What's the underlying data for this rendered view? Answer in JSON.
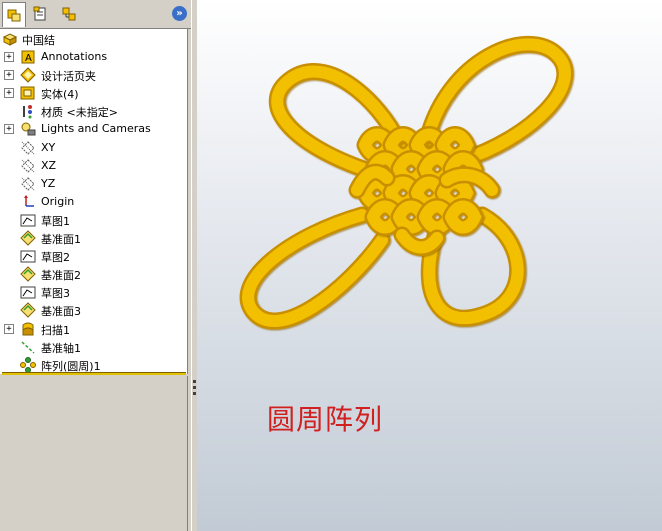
{
  "tabs": [
    {
      "name": "feature-manager",
      "icon": "feature-tree-icon"
    },
    {
      "name": "property-manager",
      "icon": "property-icon"
    },
    {
      "name": "configuration-manager",
      "icon": "configuration-icon"
    }
  ],
  "expand_glyph": "»",
  "tree": {
    "root": {
      "label": "中国结",
      "icon": "part-icon"
    },
    "items": [
      {
        "label": "Annotations",
        "icon": "annotations-icon",
        "expandable": true
      },
      {
        "label": "设计活页夹",
        "icon": "design-binder-icon",
        "expandable": true
      },
      {
        "label": "实体(4)",
        "icon": "solid-bodies-icon",
        "expandable": true
      },
      {
        "label": "材质 <未指定>",
        "icon": "material-icon",
        "expandable": false
      },
      {
        "label": "Lights and Cameras",
        "icon": "lights-cameras-icon",
        "expandable": true
      },
      {
        "label": "XY",
        "icon": "plane-icon",
        "expandable": false
      },
      {
        "label": "XZ",
        "icon": "plane-icon",
        "expandable": false
      },
      {
        "label": "YZ",
        "icon": "plane-icon",
        "expandable": false
      },
      {
        "label": "Origin",
        "icon": "origin-icon",
        "expandable": false
      },
      {
        "label": "草图1",
        "icon": "sketch-icon",
        "expandable": false
      },
      {
        "label": "基准面1",
        "icon": "reference-plane-icon",
        "expandable": false
      },
      {
        "label": "草图2",
        "icon": "sketch-icon",
        "expandable": false
      },
      {
        "label": "基准面2",
        "icon": "reference-plane-icon",
        "expandable": false
      },
      {
        "label": "草图3",
        "icon": "sketch-icon",
        "expandable": false
      },
      {
        "label": "基准面3",
        "icon": "reference-plane-icon",
        "expandable": false
      },
      {
        "label": "扫描1",
        "icon": "sweep-icon",
        "expandable": true
      },
      {
        "label": "基准轴1",
        "icon": "axis-icon",
        "expandable": false
      },
      {
        "label": "阵列(圆周)1",
        "icon": "circular-pattern-icon",
        "expandable": false
      }
    ]
  },
  "viewport": {
    "caption": "圆周阵列",
    "model_color": "#f2c000",
    "model_shade": "#c89000"
  }
}
